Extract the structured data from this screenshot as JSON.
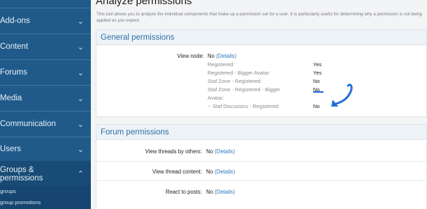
{
  "sidebar": {
    "items": [
      {
        "label": "Add-ons"
      },
      {
        "label": "Content"
      },
      {
        "label": "Forums"
      },
      {
        "label": "Media"
      },
      {
        "label": "Communication"
      },
      {
        "label": "Users"
      },
      {
        "label": "Groups & permissions"
      }
    ],
    "sub_items": [
      "groups",
      "group promotions"
    ]
  },
  "page": {
    "title": "Analyze permissions",
    "description": "This tool allows you to analyze the individual components that make up a permission set for a user. It is particularly useful for determining why a permission is not being applied as you expect."
  },
  "general": {
    "title": "General permissions",
    "view_node_label": "View node:",
    "view_node_value": "No",
    "details": "(Details)",
    "breakdown": [
      {
        "label": "Registered:",
        "value": "Yes"
      },
      {
        "label": "Registered - Bigger Avatar:",
        "value": "Yes"
      },
      {
        "label": "Staf Zone - Registered:",
        "value": "No"
      },
      {
        "label": "Staf Zone - Registered - Bigger",
        "value": "No"
      },
      {
        "label": "Avatar:",
        "value": ""
      },
      {
        "label": "-- Staf Discussics - Registered:",
        "value": "No"
      }
    ]
  },
  "forum": {
    "title": "Forum permissions",
    "rows": [
      {
        "label": "View threads by others:",
        "value": "No",
        "details": "(Details)"
      },
      {
        "label": "View thread content:",
        "value": "No",
        "details": "(Details)"
      },
      {
        "label": "React to posts:",
        "value": "No",
        "details": "(Details)"
      }
    ]
  },
  "colors": {
    "sidebar": "#1f5a8a",
    "accent": "#2d6ea3",
    "annotation": "#1f6fd6"
  }
}
